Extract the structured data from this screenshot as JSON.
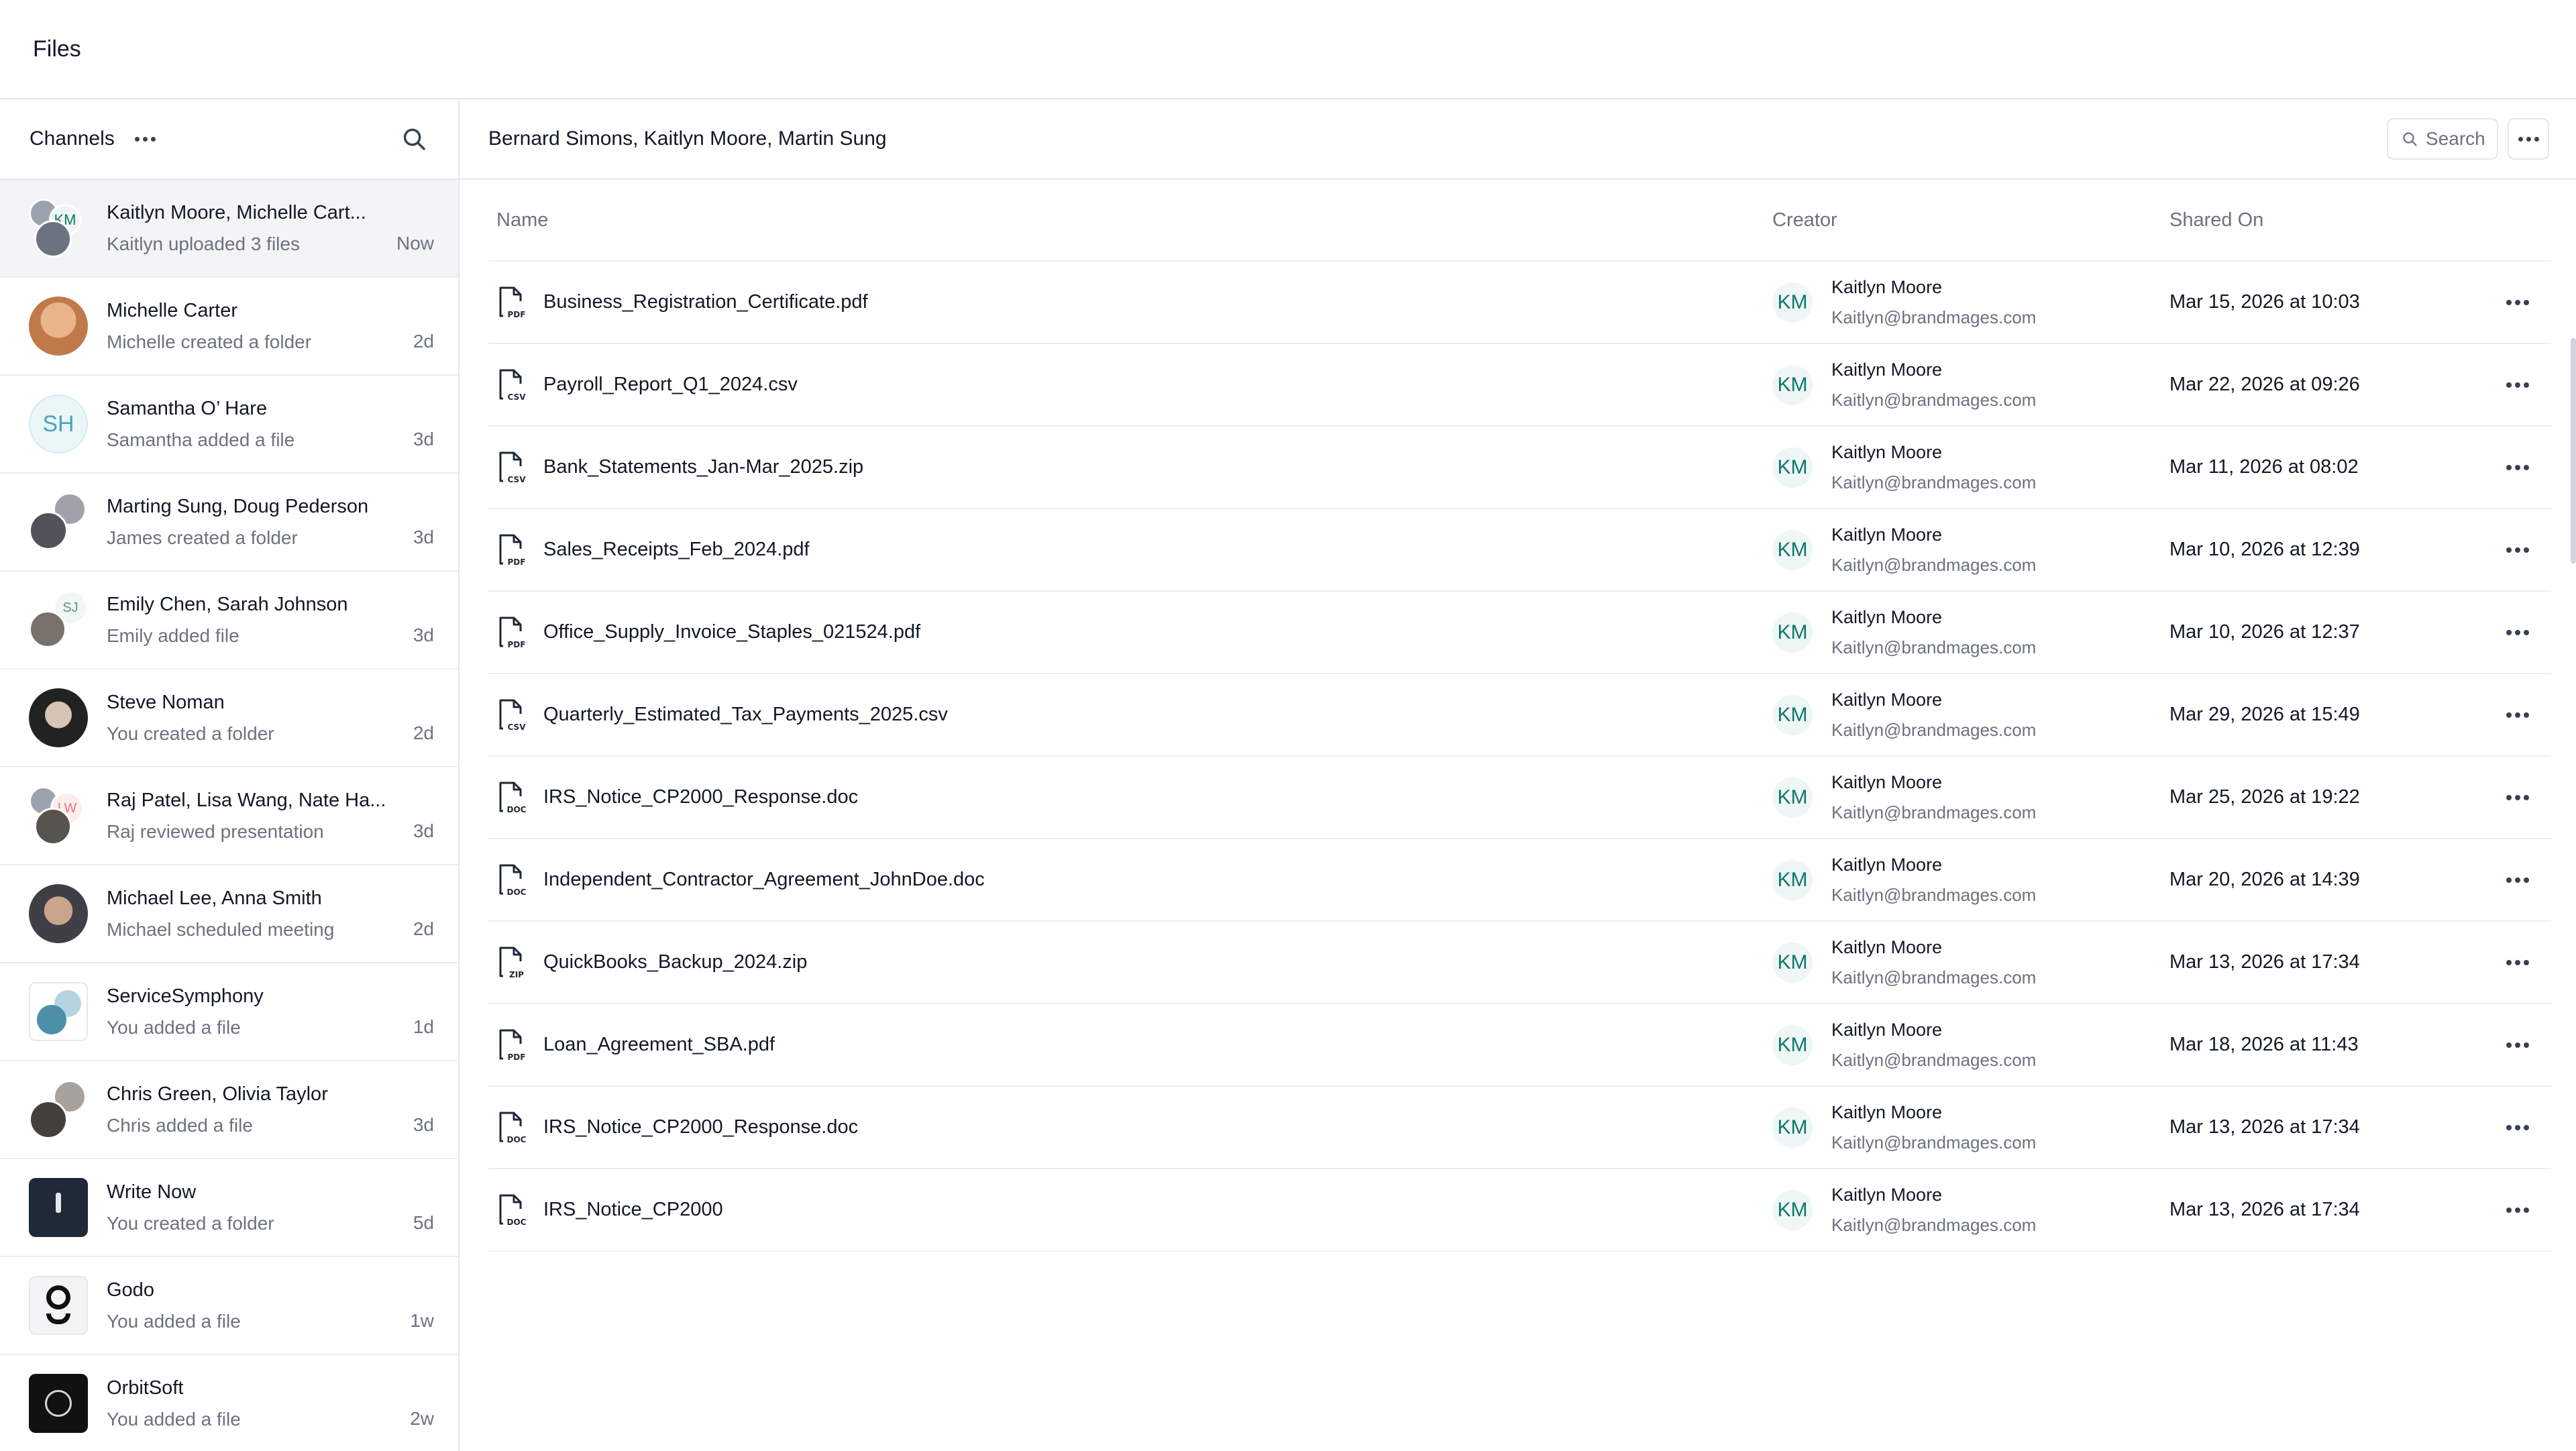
{
  "app": {
    "title": "Files"
  },
  "sidebar": {
    "header": "Channels",
    "channels": [
      {
        "name": "Kaitlyn Moore, Michelle Cart...",
        "sub": "Kaitlyn uploaded 3 files",
        "time": "Now",
        "avatar_text": "KM"
      },
      {
        "name": "Michelle Carter",
        "sub": "Michelle created a folder",
        "time": "2d"
      },
      {
        "name": "Samantha O’ Hare",
        "sub": "Samantha added a file",
        "time": "3d",
        "avatar_text": "SH"
      },
      {
        "name": "Marting Sung, Doug Pederson",
        "sub": "James created a folder",
        "time": "3d"
      },
      {
        "name": "Emily Chen, Sarah Johnson",
        "sub": "Emily added file",
        "time": "3d",
        "avatar_text": "SJ"
      },
      {
        "name": "Steve Noman",
        "sub": "You created a folder",
        "time": "2d"
      },
      {
        "name": "Raj Patel, Lisa Wang, Nate Ha...",
        "sub": "Raj reviewed presentation",
        "time": "3d",
        "avatar_text": "LW"
      },
      {
        "name": "Michael Lee, Anna Smith",
        "sub": "Michael scheduled meeting",
        "time": "2d"
      },
      {
        "name": "ServiceSymphony",
        "sub": "You added a file",
        "time": "1d"
      },
      {
        "name": "Chris Green, Olivia Taylor",
        "sub": "Chris added a file",
        "time": "3d"
      },
      {
        "name": "Write Now",
        "sub": "You created a folder",
        "time": "5d"
      },
      {
        "name": "Godo",
        "sub": "You added a file",
        "time": "1w"
      },
      {
        "name": "OrbitSoft",
        "sub": "You added a file",
        "time": "2w"
      }
    ]
  },
  "content": {
    "title": "Bernard Simons, Kaitlyn Moore, Martin Sung",
    "search_label": "Search",
    "columns": {
      "name": "Name",
      "creator": "Creator",
      "shared": "Shared On"
    },
    "files": [
      {
        "name": "Business_Registration_Certificate.pdf",
        "type": "PDF",
        "creator": "Kaitlyn Moore",
        "email": "Kaitlyn@brandmages.com",
        "initials": "KM",
        "shared": "Mar 15, 2026 at 10:03"
      },
      {
        "name": "Payroll_Report_Q1_2024.csv",
        "type": "CSV",
        "creator": "Kaitlyn Moore",
        "email": "Kaitlyn@brandmages.com",
        "initials": "KM",
        "shared": "Mar 22, 2026 at 09:26"
      },
      {
        "name": "Bank_Statements_Jan-Mar_2025.zip",
        "type": "CSV",
        "creator": "Kaitlyn Moore",
        "email": "Kaitlyn@brandmages.com",
        "initials": "KM",
        "shared": "Mar 11, 2026 at 08:02"
      },
      {
        "name": "Sales_Receipts_Feb_2024.pdf",
        "type": "PDF",
        "creator": "Kaitlyn Moore",
        "email": "Kaitlyn@brandmages.com",
        "initials": "KM",
        "shared": "Mar 10, 2026 at 12:39"
      },
      {
        "name": "Office_Supply_Invoice_Staples_021524.pdf",
        "type": "PDF",
        "creator": "Kaitlyn Moore",
        "email": "Kaitlyn@brandmages.com",
        "initials": "KM",
        "shared": "Mar 10, 2026 at 12:37"
      },
      {
        "name": "Quarterly_Estimated_Tax_Payments_2025.csv",
        "type": "CSV",
        "creator": "Kaitlyn Moore",
        "email": "Kaitlyn@brandmages.com",
        "initials": "KM",
        "shared": "Mar 29, 2026 at 15:49"
      },
      {
        "name": "IRS_Notice_CP2000_Response.doc",
        "type": "DOC",
        "creator": "Kaitlyn Moore",
        "email": "Kaitlyn@brandmages.com",
        "initials": "KM",
        "shared": "Mar 25, 2026 at 19:22"
      },
      {
        "name": "Independent_Contractor_Agreement_JohnDoe.doc",
        "type": "DOC",
        "creator": "Kaitlyn Moore",
        "email": "Kaitlyn@brandmages.com",
        "initials": "KM",
        "shared": "Mar 20, 2026 at 14:39"
      },
      {
        "name": "QuickBooks_Backup_2024.zip",
        "type": "ZIP",
        "creator": "Kaitlyn Moore",
        "email": "Kaitlyn@brandmages.com",
        "initials": "KM",
        "shared": "Mar 13, 2026 at 17:34"
      },
      {
        "name": "Loan_Agreement_SBA.pdf",
        "type": "PDF",
        "creator": "Kaitlyn Moore",
        "email": "Kaitlyn@brandmages.com",
        "initials": "KM",
        "shared": "Mar 18, 2026 at 11:43"
      },
      {
        "name": "IRS_Notice_CP2000_Response.doc",
        "type": "DOC",
        "creator": "Kaitlyn Moore",
        "email": "Kaitlyn@brandmages.com",
        "initials": "KM",
        "shared": "Mar 13, 2026 at 17:34"
      },
      {
        "name": "IRS_Notice_CP2000",
        "type": "DOC",
        "creator": "Kaitlyn Moore",
        "email": "Kaitlyn@brandmages.com",
        "initials": "KM",
        "shared": "Mar 13, 2026 at 17:34"
      }
    ]
  },
  "colors": {
    "accent": "#0f766e",
    "border": "#e5e7eb",
    "muted": "#6b7280",
    "text": "#111827"
  }
}
